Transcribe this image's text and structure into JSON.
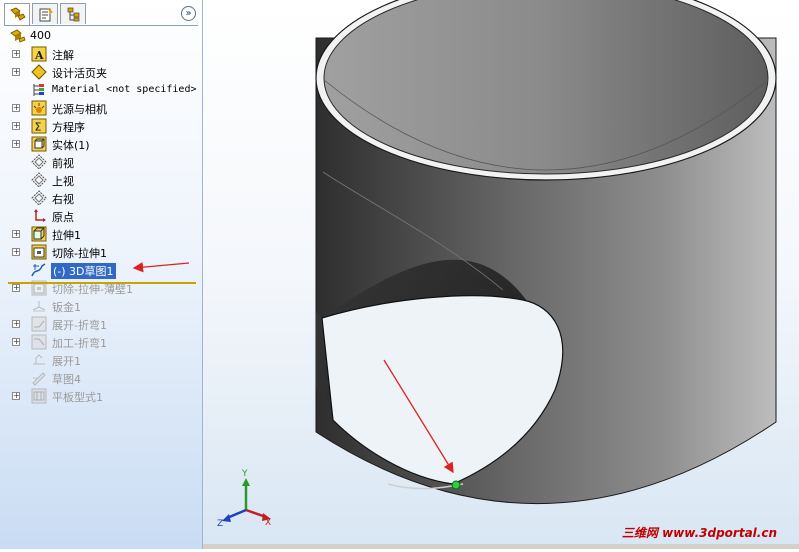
{
  "tree": {
    "root": "400",
    "items": [
      {
        "label": "注解",
        "icon": "annotation-icon",
        "expander": true
      },
      {
        "label": "设计活页夹",
        "icon": "design-binder-icon",
        "expander": true
      },
      {
        "label": "Material <not specified>",
        "icon": "material-icon",
        "expander": false
      },
      {
        "label": "光源与相机",
        "icon": "lights-camera-icon",
        "expander": true
      },
      {
        "label": "方程序",
        "icon": "equations-icon",
        "expander": true
      },
      {
        "label": "实体(1)",
        "icon": "solid-bodies-icon",
        "expander": true
      },
      {
        "label": "前视",
        "icon": "plane-icon",
        "expander": false
      },
      {
        "label": "上视",
        "icon": "plane-icon",
        "expander": false
      },
      {
        "label": "右视",
        "icon": "plane-icon",
        "expander": false
      },
      {
        "label": "原点",
        "icon": "origin-icon",
        "expander": false
      },
      {
        "label": "拉伸1",
        "icon": "extrude-icon",
        "expander": true
      },
      {
        "label": "切除-拉伸1",
        "icon": "cut-extrude-icon",
        "expander": true
      },
      {
        "label": "(-) 3D草图1",
        "icon": "3d-sketch-icon",
        "expander": false,
        "selected": true
      },
      {
        "label": "切除-拉伸-薄壁1",
        "icon": "cut-thin-icon",
        "expander": true,
        "dim": true
      },
      {
        "label": "钣金1",
        "icon": "sheet-metal-icon",
        "expander": false,
        "dim": true
      },
      {
        "label": "展开-折弯1",
        "icon": "unfold-icon",
        "expander": true,
        "dim": true
      },
      {
        "label": "加工-折弯1",
        "icon": "process-bend-icon",
        "expander": true,
        "dim": true
      },
      {
        "label": "展开1",
        "icon": "flatten-icon",
        "expander": false,
        "dim": true
      },
      {
        "label": "草图4",
        "icon": "sketch-icon",
        "expander": false,
        "dim": true
      },
      {
        "label": "平板型式1",
        "icon": "flat-pattern-icon",
        "expander": true,
        "dim": true
      }
    ]
  },
  "triad": {
    "x": "X",
    "y": "Y",
    "z": "Z"
  },
  "watermark": {
    "cn": "三维网",
    "url": "www.3dportal.cn"
  },
  "colors": {
    "selection": "#316ac5",
    "arrow": "#e02020",
    "rollback": "#c8a400",
    "sketch_point": "#2ecc40"
  }
}
